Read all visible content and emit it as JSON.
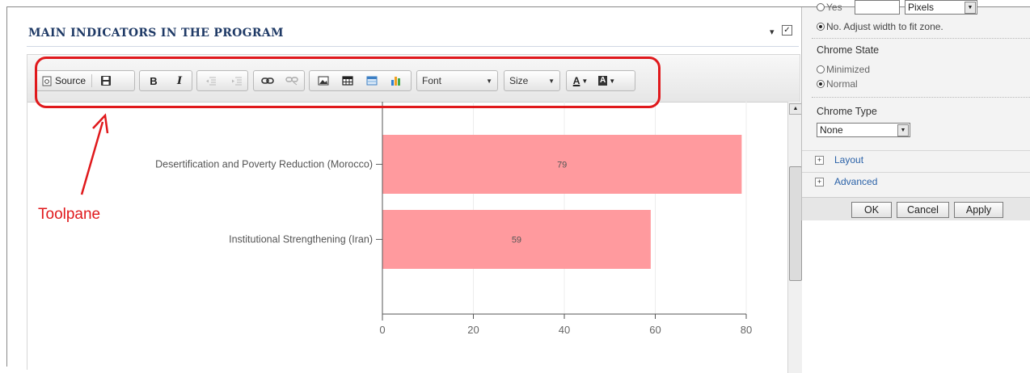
{
  "webpart": {
    "title": "MAIN INDICATORS IN THE PROGRAM",
    "menu_glyph": "▾",
    "check_glyph": "☑"
  },
  "toolbar": {
    "source_label": "Source",
    "bold_label": "B",
    "italic_label": "I",
    "font_label": "Font",
    "size_label": "Size",
    "font_color_label": "A",
    "bg_color_label": "A"
  },
  "annotation": {
    "label": "Toolpane"
  },
  "chart_data": {
    "type": "bar",
    "orientation": "horizontal",
    "categories": [
      "Desertification and Poverty Reduction (Morocco)",
      "Institutional Strengthening (Iran)"
    ],
    "values": [
      79,
      59
    ],
    "data_labels": [
      "79",
      "59"
    ],
    "xlim": [
      0,
      80
    ],
    "xticks": [
      "0",
      "20",
      "40",
      "60",
      "80"
    ],
    "bar_color": "#ff9a9e",
    "grid": true
  },
  "toolpane": {
    "width_radio_partial": "Yes",
    "width_units": "Pixels",
    "width_no_label": "No. Adjust width to fit zone.",
    "chrome_state_label": "Chrome State",
    "minimized_label": "Minimized",
    "normal_label": "Normal",
    "chrome_type_label": "Chrome Type",
    "chrome_type_value": "None",
    "layout_label": "Layout",
    "advanced_label": "Advanced",
    "ok_label": "OK",
    "cancel_label": "Cancel",
    "apply_label": "Apply"
  }
}
